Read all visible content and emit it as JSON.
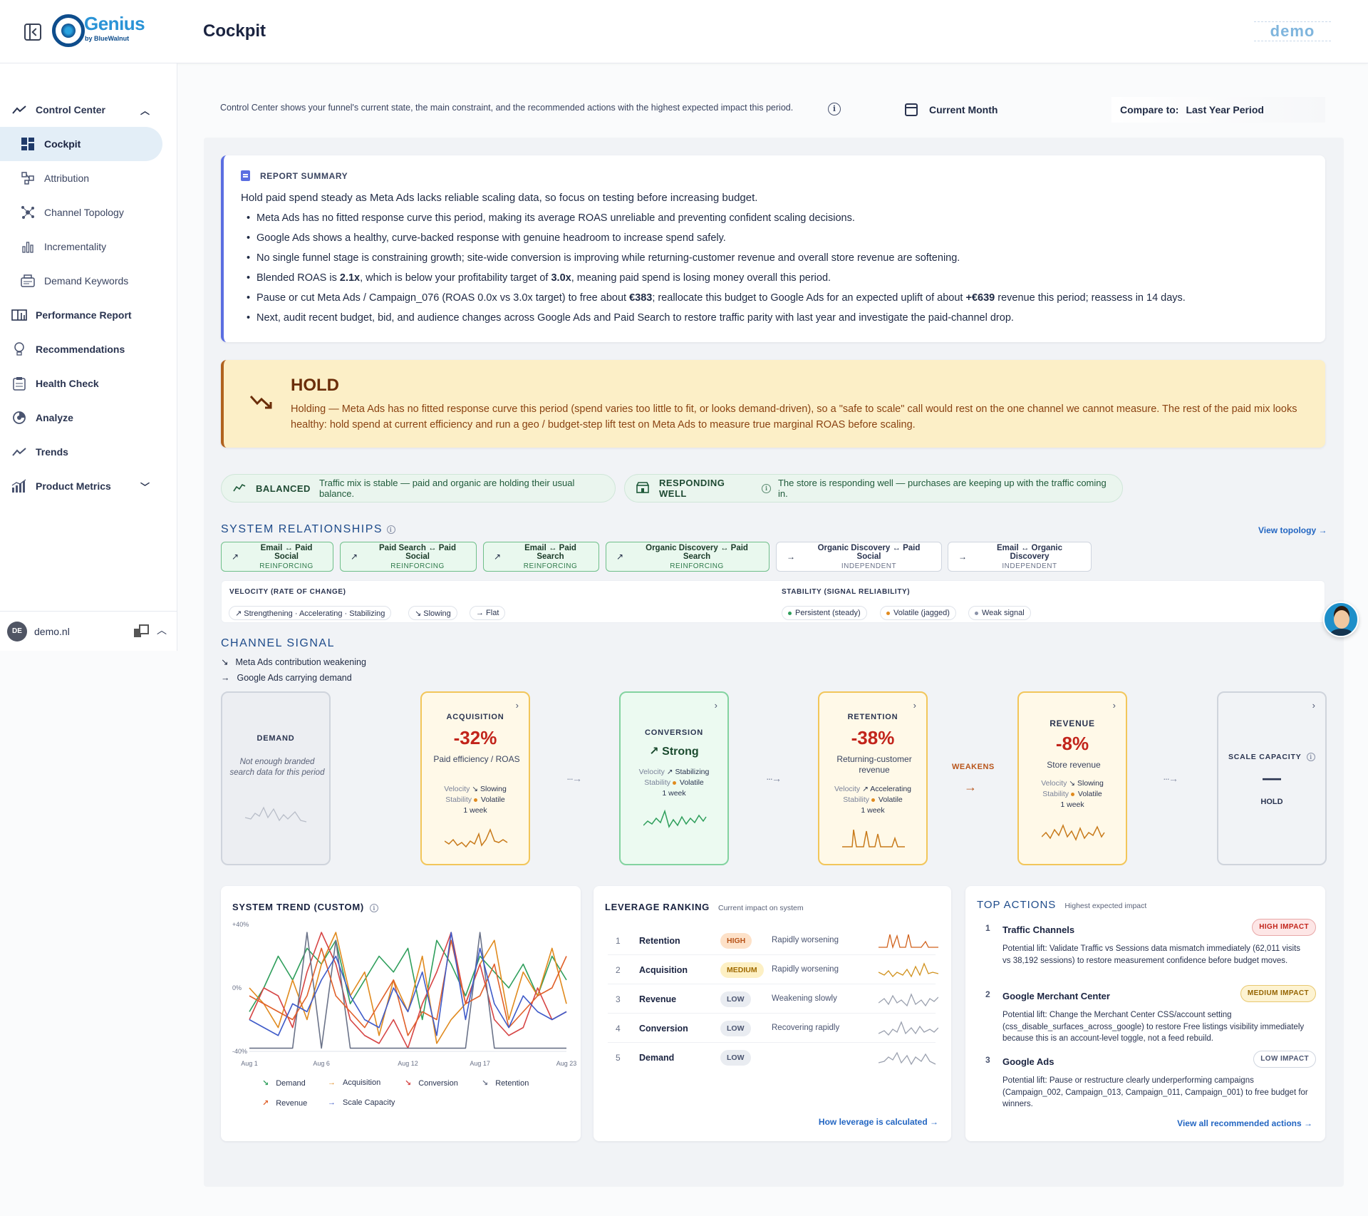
{
  "header": {
    "logo_text": "Genius",
    "logo_sub": "by BlueWalnut",
    "page_title": "Cockpit",
    "demo_badge": "demo"
  },
  "sidebar": {
    "items": [
      {
        "label": "Control Center",
        "icon": "trend-line-icon",
        "expanded": true
      },
      {
        "label": "Cockpit",
        "icon": "dashboard-icon",
        "active": true
      },
      {
        "label": "Attribution",
        "icon": "attribution-icon"
      },
      {
        "label": "Channel Topology",
        "icon": "topology-icon"
      },
      {
        "label": "Incrementality",
        "icon": "bar-chart-icon"
      },
      {
        "label": "Demand Keywords",
        "icon": "keywords-icon"
      },
      {
        "label": "Performance Report",
        "icon": "report-icon"
      },
      {
        "label": "Recommendations",
        "icon": "lightbulb-icon"
      },
      {
        "label": "Health Check",
        "icon": "clipboard-icon"
      },
      {
        "label": "Analyze",
        "icon": "analyze-icon"
      },
      {
        "label": "Trends",
        "icon": "trend-line-icon"
      },
      {
        "label": "Product Metrics",
        "icon": "metrics-icon",
        "expandable": true
      }
    ],
    "footer": {
      "avatar": "DE",
      "name": "demo.nl"
    }
  },
  "intro": {
    "text": "Control Center shows your funnel's current state, the main constraint, and the recommended actions with the highest expected impact this period.",
    "period": "Current Month",
    "compare_label": "Compare to:",
    "compare_value": "Last Year Period"
  },
  "summary": {
    "heading": "REPORT SUMMARY",
    "lead": "Hold paid spend steady as Meta Ads lacks reliable scaling data, so focus on testing before increasing budget.",
    "b1": "Meta Ads has no fitted response curve this period, making its average ROAS unreliable and preventing confident scaling decisions.",
    "b2": "Google Ads shows a healthy, curve-backed response with genuine headroom to increase spend safely.",
    "b3": "No single funnel stage is constraining growth; site-wide conversion is improving while returning-customer revenue and overall store revenue are softening.",
    "b4_a": "Blended ROAS is ",
    "b4_v1": "2.1x",
    "b4_b": ", which is below your profitability target of ",
    "b4_v2": "3.0x",
    "b4_c": ", meaning paid spend is losing money overall this period.",
    "b5_a": "Pause or cut Meta Ads / Campaign_076 (ROAS 0.0x vs 3.0x target) to free about ",
    "b5_v1": "€383",
    "b5_b": "; reallocate this budget to Google Ads for an expected uplift of about ",
    "b5_v2": "+€639",
    "b5_c": " revenue this period; reassess in 14 days.",
    "b6": "Next, audit recent budget, bid, and audience changes across Google Ads and Paid Search to restore traffic parity with last year and investigate the paid-channel drop."
  },
  "hold": {
    "title": "HOLD",
    "text": "Holding — Meta Ads has no fitted response curve this period (spend varies too little to fit, or looks demand-driven), so a \"safe to scale\" call would rest on the one channel we cannot measure. The rest of the paid mix looks healthy: hold spend at current efficiency and run a geo / budget-step lift test on Meta Ads to measure true marginal ROAS before scaling."
  },
  "status_pills": [
    {
      "label": "BALANCED",
      "text": "Traffic mix is stable — paid and organic are holding their usual balance."
    },
    {
      "label": "RESPONDING WELL",
      "text": "The store is responding well — purchases are keeping up with the traffic coming in."
    }
  ],
  "relationships": {
    "title": "SYSTEM RELATIONSHIPS",
    "link": "View topology →",
    "chips": [
      {
        "pair": "Email ↔ Paid Social",
        "kind": "REINFORCING"
      },
      {
        "pair": "Paid Search ↔ Paid Social",
        "kind": "REINFORCING"
      },
      {
        "pair": "Email ↔ Paid Search",
        "kind": "REINFORCING"
      },
      {
        "pair": "Organic Discovery ↔ Paid Search",
        "kind": "REINFORCING"
      },
      {
        "pair": "Organic Discovery ↔ Paid Social",
        "kind": "INDEPENDENT"
      },
      {
        "pair": "Email ↔ Organic Discovery",
        "kind": "INDEPENDENT"
      }
    ],
    "velocity_head": "VELOCITY (RATE OF CHANGE)",
    "velocity_items": [
      "↗ Strengthening · Accelerating · Stabilizing",
      "↘ Slowing",
      "→ Flat"
    ],
    "stability_head": "STABILITY (SIGNAL RELIABILITY)",
    "stability_items": [
      "Persistent (steady)",
      "Volatile (jagged)",
      "Weak signal"
    ],
    "colors": {
      "green": "#2e9e5b",
      "orange": "#e08a1e",
      "gray": "#8a92a8"
    }
  },
  "channel_signal": {
    "title": "CHANNEL SIGNAL",
    "notes": [
      {
        "arrow": "↘",
        "text": "Meta Ads contribution weakening"
      },
      {
        "arrow": "→",
        "text": "Google Ads carrying demand"
      }
    ],
    "velocity_label": "Velocity",
    "stability_label": "Stability",
    "stages": [
      {
        "name": "DEMAND",
        "sub": "Not enough branded search data for this period"
      },
      {
        "name": "ACQUISITION",
        "value": "-32%",
        "sub": "Paid efficiency / ROAS",
        "velocity": "↘ Slowing",
        "stability": "Volatile",
        "window": "1 week"
      },
      {
        "name": "CONVERSION",
        "value": "↗ Strong",
        "velocity": "↗ Stabilizing",
        "stability": "Volatile",
        "window": "1 week"
      },
      {
        "name": "RETENTION",
        "value": "-38%",
        "sub": "Returning-customer revenue",
        "velocity": "↗ Accelerating",
        "stability": "Volatile",
        "window": "1 week"
      },
      {
        "name": "REVENUE",
        "value": "-8%",
        "sub": "Store revenue",
        "velocity": "↘ Slowing",
        "stability": "Volatile",
        "window": "1 week"
      },
      {
        "name": "SCALE CAPACITY",
        "value": "—",
        "sub": "HOLD"
      }
    ],
    "weakens": "WEAKENS"
  },
  "system_trend": {
    "title": "SYSTEM TREND (CUSTOM)",
    "legend": [
      {
        "arrow": "↘",
        "name": "Demand",
        "color": "#2e9e5b"
      },
      {
        "arrow": "→",
        "name": "Acquisition",
        "color": "#e08a1e"
      },
      {
        "arrow": "↘",
        "name": "Conversion",
        "color": "#d64545"
      },
      {
        "arrow": "↘",
        "name": "Retention",
        "color": "#6a7288"
      },
      {
        "arrow": "↗",
        "name": "Revenue",
        "color": "#e0602a"
      },
      {
        "arrow": "→",
        "name": "Scale Capacity",
        "color": "#3f5bc9"
      }
    ]
  },
  "chart_data": {
    "type": "line",
    "title": "SYSTEM TREND (CUSTOM)",
    "x": [
      "Aug 1",
      "Aug 2",
      "Aug 3",
      "Aug 4",
      "Aug 5",
      "Aug 6",
      "Aug 7",
      "Aug 8",
      "Aug 9",
      "Aug 10",
      "Aug 11",
      "Aug 12",
      "Aug 13",
      "Aug 14",
      "Aug 15",
      "Aug 16",
      "Aug 17",
      "Aug 18",
      "Aug 19",
      "Aug 20",
      "Aug 21",
      "Aug 22",
      "Aug 23"
    ],
    "x_ticks": [
      "Aug 1",
      "Aug 6",
      "Aug 12",
      "Aug 17",
      "Aug 23"
    ],
    "y_ticks": [
      "+40%",
      "0%",
      "-40%"
    ],
    "ylim": [
      -40,
      40
    ],
    "series": [
      {
        "name": "Demand",
        "color": "#2e9e5b",
        "values": [
          -15,
          0,
          20,
          5,
          25,
          15,
          30,
          -10,
          5,
          20,
          10,
          25,
          -20,
          30,
          15,
          -5,
          20,
          10,
          0,
          15,
          -5,
          20,
          5
        ]
      },
      {
        "name": "Acquisition",
        "color": "#e08a1e",
        "values": [
          0,
          -10,
          -25,
          5,
          -20,
          15,
          35,
          -5,
          10,
          -30,
          5,
          -15,
          20,
          -35,
          -20,
          -10,
          15,
          30,
          -20,
          10,
          -5,
          25,
          -10
        ]
      },
      {
        "name": "Conversion",
        "color": "#d64545",
        "values": [
          -20,
          0,
          -5,
          -25,
          10,
          35,
          15,
          -20,
          -30,
          -35,
          -20,
          -38,
          -10,
          10,
          35,
          -10,
          15,
          -20,
          -30,
          -25,
          0,
          -20,
          -15
        ]
      },
      {
        "name": "Retention",
        "color": "#6a7288",
        "values": [
          -38,
          -38,
          -38,
          -38,
          35,
          -38,
          30,
          -38,
          -38,
          -38,
          -38,
          -38,
          -38,
          -38,
          -38,
          -38,
          35,
          -38,
          -38,
          -38,
          -38,
          -38,
          -38
        ]
      },
      {
        "name": "Revenue",
        "color": "#e0602a",
        "values": [
          -5,
          -10,
          -15,
          -20,
          -5,
          25,
          -5,
          -15,
          -25,
          -10,
          5,
          -30,
          -15,
          -20,
          30,
          -10,
          -5,
          15,
          -25,
          -15,
          -5,
          0,
          20
        ]
      },
      {
        "name": "Scale Capacity",
        "color": "#3f5bc9",
        "values": [
          -20,
          -25,
          -30,
          -10,
          -15,
          5,
          20,
          -5,
          -20,
          -25,
          0,
          -15,
          10,
          -30,
          35,
          -20,
          25,
          -10,
          -25,
          -5,
          -15,
          -20,
          -15
        ]
      }
    ]
  },
  "leverage": {
    "title": "LEVERAGE RANKING",
    "subtitle": "Current impact on system",
    "rows": [
      {
        "n": "1",
        "name": "Retention",
        "badge": "HIGH",
        "desc": "Rapidly worsening"
      },
      {
        "n": "2",
        "name": "Acquisition",
        "badge": "MEDIUM",
        "desc": "Rapidly worsening"
      },
      {
        "n": "3",
        "name": "Revenue",
        "badge": "LOW",
        "desc": "Weakening slowly"
      },
      {
        "n": "4",
        "name": "Conversion",
        "badge": "LOW",
        "desc": "Recovering rapidly"
      },
      {
        "n": "5",
        "name": "Demand",
        "badge": "LOW",
        "desc": ""
      }
    ],
    "link": "How leverage is calculated →"
  },
  "top_actions": {
    "title": "TOP ACTIONS",
    "subtitle": "Highest expected impact",
    "items": [
      {
        "n": "1",
        "title": "Traffic Channels",
        "impact": "HIGH IMPACT",
        "desc": "Potential lift: Validate Traffic vs Sessions data mismatch immediately (62,011 visits vs 38,192 sessions) to restore measurement confidence before budget moves."
      },
      {
        "n": "2",
        "title": "Google Merchant Center",
        "impact": "MEDIUM IMPACT",
        "desc": "Potential lift: Change the Merchant Center CSS/account setting (css_disable_surfaces_across_google) to restore Free listings visibility immediately because this is an account-level toggle, not a feed rebuild."
      },
      {
        "n": "3",
        "title": "Google Ads",
        "impact": "LOW IMPACT",
        "desc": "Potential lift: Pause or restructure clearly underperforming campaigns (Campaign_002, Campaign_013, Campaign_011, Campaign_001) to free budget for winners."
      }
    ],
    "link": "View all recommended actions →"
  }
}
